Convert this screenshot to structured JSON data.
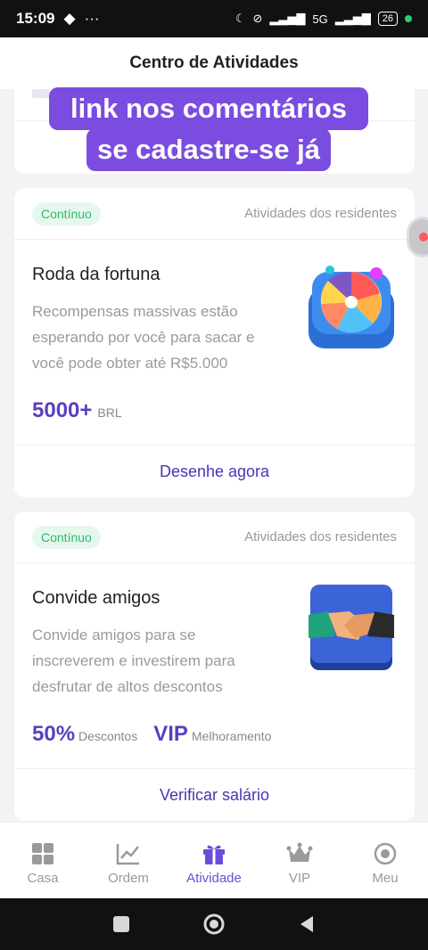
{
  "status": {
    "time": "15:09",
    "network": "5G",
    "battery": "26"
  },
  "header": {
    "title": "Centro de Atividades"
  },
  "overlay": {
    "line1": "link nos comentários",
    "line2": "se cadastre-se já"
  },
  "cards": [
    {
      "badge": "Contínuo",
      "category": "Atividades dos residentes",
      "title": "Roda da fortuna",
      "description": "Recompensas massivas estão esperando por você para sacar e você pode obter até R$5.000",
      "stat_value": "5000+",
      "stat_unit": "BRL",
      "action": "Desenhe agora"
    },
    {
      "badge": "Contínuo",
      "category": "Atividades dos residentes",
      "title": "Convide amigos",
      "description": "Convide amigos para se inscreverem e investirem para desfrutar de altos descontos",
      "stat_value": "50%",
      "stat_unit": "Descontos",
      "stat2_value": "VIP",
      "stat2_unit": "Melhoramento",
      "action": "Verificar salário"
    }
  ],
  "nav": {
    "items": [
      {
        "label": "Casa",
        "icon": "grid-icon"
      },
      {
        "label": "Ordem",
        "icon": "chart-icon"
      },
      {
        "label": "Atividade",
        "icon": "gift-icon",
        "active": true
      },
      {
        "label": "VIP",
        "icon": "crown-icon"
      },
      {
        "label": "Meu",
        "icon": "user-icon"
      }
    ]
  },
  "colors": {
    "accent": "#6b4ddb",
    "badge_bg": "#e6f7ee",
    "badge_text": "#2fb96a",
    "overlay": "#7b4ce0"
  }
}
